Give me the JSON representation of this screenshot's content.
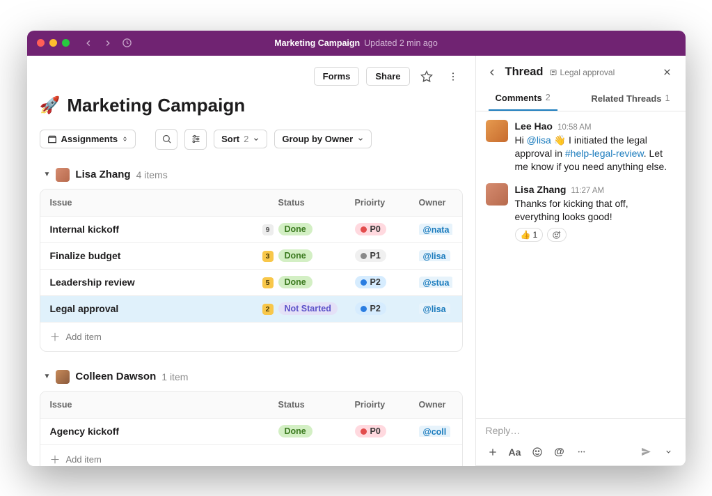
{
  "titlebar": {
    "title": "Marketing Campaign",
    "subtitle": "Updated 2 min ago"
  },
  "toolbar": {
    "forms": "Forms",
    "share": "Share"
  },
  "page": {
    "emoji": "🚀",
    "title": "Marketing Campaign"
  },
  "filters": {
    "assignments": "Assignments",
    "sort_label": "Sort",
    "sort_count": "2",
    "group_by_label": "Group by Owner"
  },
  "columns": {
    "issue": "Issue",
    "status": "Status",
    "priority": "Prioirty",
    "owner": "Owner"
  },
  "groups": [
    {
      "owner": "Lisa Zhang",
      "meta": "4 items",
      "avatar_class": "lisa",
      "rows": [
        {
          "issue": "Internal kickoff",
          "count": "9",
          "count_style": "gray",
          "status": "Done",
          "status_style": "done",
          "priority": "P0",
          "priority_style": "pr0",
          "dot": "d-red",
          "owner": "@nata",
          "selected": false
        },
        {
          "issue": "Finalize budget",
          "count": "3",
          "count_style": "yellow",
          "status": "Done",
          "status_style": "done",
          "priority": "P1",
          "priority_style": "pr1",
          "dot": "d-gray",
          "owner": "@lisa",
          "selected": false
        },
        {
          "issue": "Leadership review",
          "count": "5",
          "count_style": "yellow",
          "status": "Done",
          "status_style": "done",
          "priority": "P2",
          "priority_style": "pr2",
          "dot": "d-blue",
          "owner": "@stua",
          "selected": false
        },
        {
          "issue": "Legal approval",
          "count": "2",
          "count_style": "yellow",
          "status": "Not Started",
          "status_style": "notstarted",
          "priority": "P2",
          "priority_style": "pr2",
          "dot": "d-blue",
          "owner": "@lisa",
          "selected": true
        }
      ],
      "add_item": "Add item"
    },
    {
      "owner": "Colleen Dawson",
      "meta": "1 item",
      "avatar_class": "colleen",
      "rows": [
        {
          "issue": "Agency kickoff",
          "count": "",
          "count_style": "",
          "status": "Done",
          "status_style": "done",
          "priority": "P0",
          "priority_style": "pr0",
          "dot": "d-red",
          "owner": "@coll",
          "selected": false
        }
      ],
      "add_item": "Add item"
    }
  ],
  "panel": {
    "title": "Thread",
    "subtitle": "Legal approval",
    "tabs": {
      "comments_label": "Comments",
      "comments_count": "2",
      "related_label": "Related Threads",
      "related_count": "1"
    },
    "messages": [
      {
        "author": "Lee Hao",
        "time": "10:58 AM",
        "avatar_class": "lee",
        "parts": [
          {
            "t": "text",
            "v": "Hi "
          },
          {
            "t": "mention",
            "v": "@lisa"
          },
          {
            "t": "text",
            "v": " 👋 I initiated the legal approval in "
          },
          {
            "t": "mention",
            "v": "#help-legal-review"
          },
          {
            "t": "text",
            "v": ". Let me know if you need anything else."
          }
        ],
        "reactions": []
      },
      {
        "author": "Lisa Zhang",
        "time": "11:27 AM",
        "avatar_class": "lisa",
        "parts": [
          {
            "t": "text",
            "v": "Thanks for kicking that off, everything looks good!"
          }
        ],
        "reactions": [
          {
            "emoji": "👍",
            "count": "1"
          }
        ]
      }
    ],
    "reply_placeholder": "Reply…"
  }
}
